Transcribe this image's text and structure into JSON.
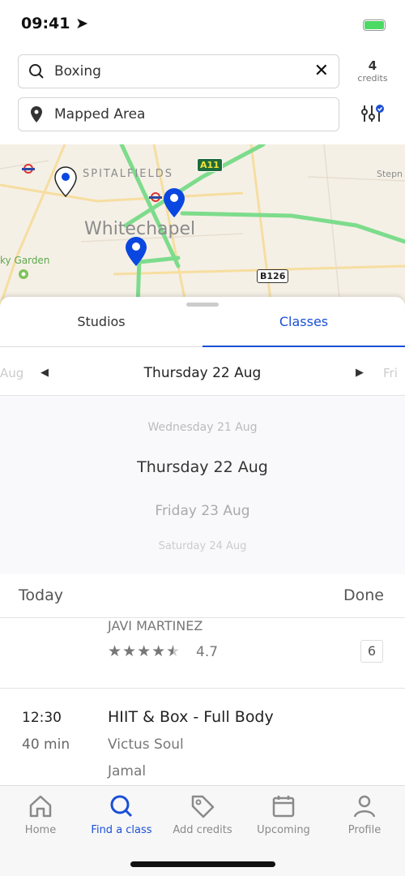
{
  "status": {
    "time": "09:41"
  },
  "search": {
    "value": "Boxing",
    "location": "Mapped Area"
  },
  "credits": {
    "count": "4",
    "label": "credits"
  },
  "map": {
    "labels": {
      "spitalfields": "SPITALFIELDS",
      "whitechapel": "Whitechapel",
      "sky_garden": "ky Garden",
      "stepney": "Stepn",
      "a11": "A11",
      "b126": "B126"
    }
  },
  "tabs": [
    {
      "label": "Studios",
      "active": false
    },
    {
      "label": "Classes",
      "active": true
    }
  ],
  "date_nav": {
    "prev": "Aug",
    "current": "Thursday 22 Aug",
    "next": "Fri"
  },
  "picker": {
    "options": [
      "Wednesday 21 Aug",
      "Thursday 22 Aug",
      "Friday 23 Aug",
      "Saturday 24 Aug"
    ],
    "selected": "Thursday 22 Aug"
  },
  "picker_toolbar": {
    "today": "Today",
    "done": "Done"
  },
  "classes": [
    {
      "instructor": "JAVI MARTINEZ",
      "rating": "4.7",
      "stars": 4.5,
      "spots": "6"
    },
    {
      "time": "12:30",
      "duration": "40 min",
      "title": "HIIT & Box - Full Body",
      "studio": "Victus Soul",
      "instructor": "Jamal"
    }
  ],
  "tabbar": [
    {
      "label": "Home"
    },
    {
      "label": "Find a class",
      "active": true
    },
    {
      "label": "Add credits"
    },
    {
      "label": "Upcoming"
    },
    {
      "label": "Profile"
    }
  ],
  "colors": {
    "accent": "#1a4fd6",
    "route": "#7ddc8c",
    "pin": "#0a47e0"
  }
}
